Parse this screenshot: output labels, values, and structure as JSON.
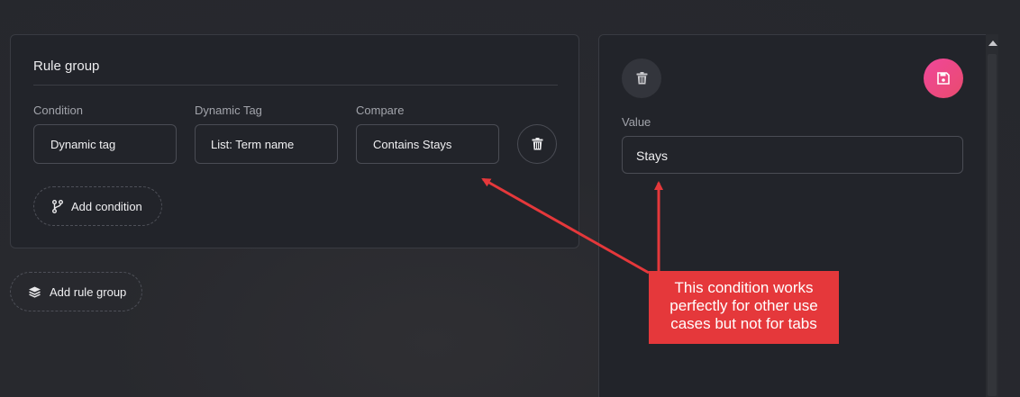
{
  "rule_group": {
    "title": "Rule group",
    "columns": [
      {
        "label": "Condition",
        "value": "Dynamic tag"
      },
      {
        "label": "Dynamic Tag",
        "value": "List: Term name"
      },
      {
        "label": "Compare",
        "value": "Contains  Stays"
      }
    ],
    "add_condition_label": "Add condition",
    "delete_icon": "trash-icon",
    "branch_icon": "branch-icon"
  },
  "add_rule_group_label": "Add rule group",
  "layers_icon": "layers-icon",
  "value_panel": {
    "label": "Value",
    "value": "Stays",
    "save_icon": "floppy-disk-icon",
    "delete_icon": "trash-icon"
  },
  "annotation": {
    "text": "This condition works perfectly for other use cases but not for tabs",
    "color": "#e5383b"
  },
  "colors": {
    "panel_bg": "#22242a",
    "page_bg": "#26282d",
    "accent_gradient_start": "#f0479a",
    "accent_gradient_end": "#e94b6e",
    "border": "#4a4c54"
  }
}
